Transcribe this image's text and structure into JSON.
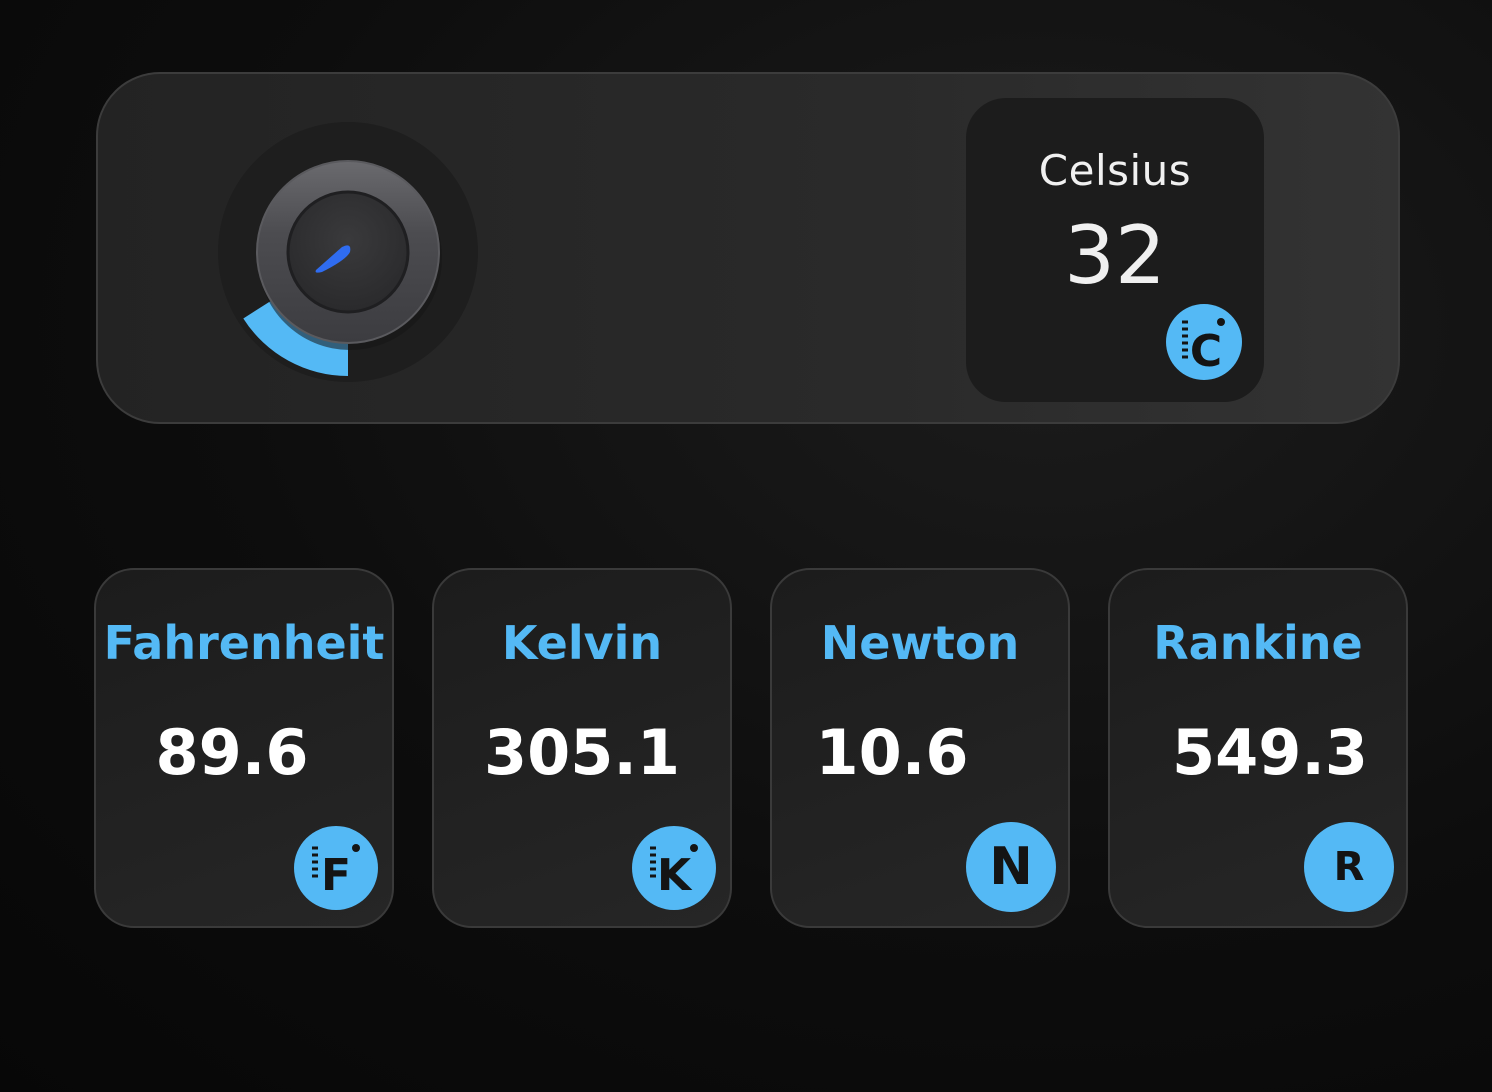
{
  "colors": {
    "accent": "#54b9f5",
    "needle": "#2f6cf0",
    "panel": "#2a2a2a",
    "card": "#1c1c1c"
  },
  "dial": {
    "icon": "temperature-knob-icon",
    "level_fraction": 0.16
  },
  "main": {
    "title": "Celsius",
    "value": "32",
    "badge_icon": "celsius-icon",
    "badge_letter": "C"
  },
  "units": [
    {
      "label": "Fahrenheit",
      "value": "89.6",
      "badge_icon": "fahrenheit-icon",
      "badge_letter": "F"
    },
    {
      "label": "Kelvin",
      "value": "305.1",
      "badge_icon": "kelvin-icon",
      "badge_letter": "K"
    },
    {
      "label": "Newton",
      "value": "10.6",
      "badge_icon": "newton-icon",
      "badge_letter": "N"
    },
    {
      "label": "Rankine",
      "value": "549.3",
      "badge_icon": "rankine-icon",
      "badge_letter": "R"
    }
  ]
}
